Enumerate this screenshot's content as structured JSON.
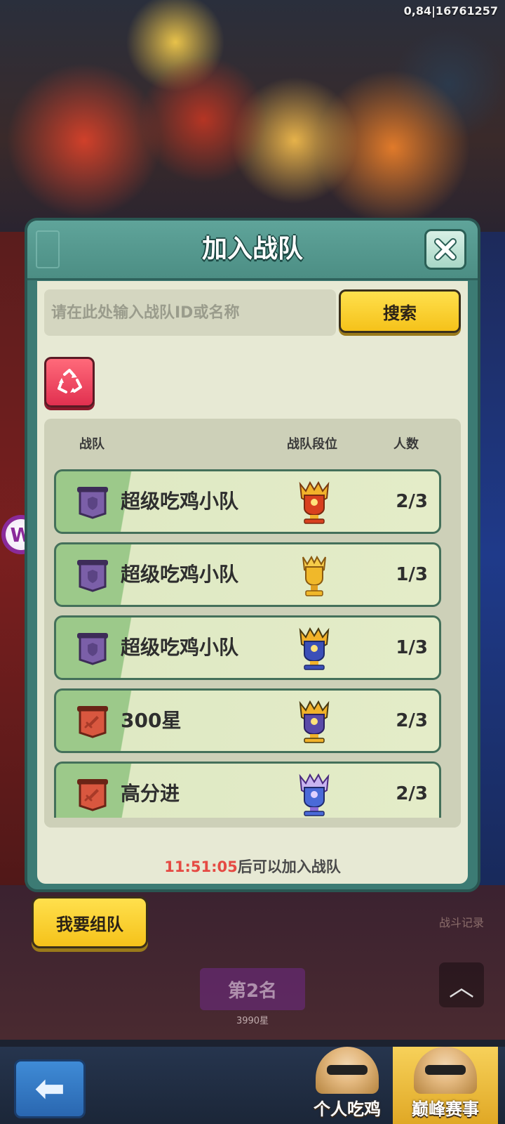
{
  "status": {
    "debug_text": "0,84|16761257"
  },
  "background": {
    "rank_label": "第2名",
    "rank_stars": "3990星",
    "side_link": "战斗记录"
  },
  "dialog": {
    "title": "加入战队",
    "search": {
      "placeholder": "请在此处输入战队ID或名称",
      "value": "",
      "button_label": "搜索"
    },
    "columns": {
      "team": "战队",
      "rank": "战队段位",
      "count": "人数"
    },
    "teams": [
      {
        "name": "超级吃鸡小队",
        "count": "2/3",
        "emblem": "shield-icon",
        "trophy": "red-gold-trophy-icon"
      },
      {
        "name": "超级吃鸡小队",
        "count": "1/3",
        "emblem": "shield-icon",
        "trophy": "gold-trophy-icon"
      },
      {
        "name": "超级吃鸡小队",
        "count": "1/3",
        "emblem": "shield-icon",
        "trophy": "blue-gold-trophy-icon"
      },
      {
        "name": "300星",
        "count": "2/3",
        "emblem": "sword-icon",
        "trophy": "blue-gold-trophy-icon"
      },
      {
        "name": "高分进",
        "count": "2/3",
        "emblem": "sword-icon",
        "trophy": "blue-purple-trophy-icon"
      }
    ],
    "cooldown": {
      "time": "11:51:05",
      "suffix": "后可以加入战队"
    }
  },
  "form_team_label": "我要组队",
  "bottom_nav": {
    "tabs": [
      {
        "label": "个人吃鸡",
        "active": false
      },
      {
        "label": "巅峰赛事",
        "active": true
      }
    ]
  },
  "colors": {
    "dialog_frame": "#3c7b74",
    "dialog_body": "#e7e9d4",
    "accent_yellow": "#f5c21a",
    "refresh_red": "#e13050",
    "cooldown_red": "#e54a43",
    "purple_emblem": "#7b5fa8",
    "red_emblem": "#d9573f"
  }
}
